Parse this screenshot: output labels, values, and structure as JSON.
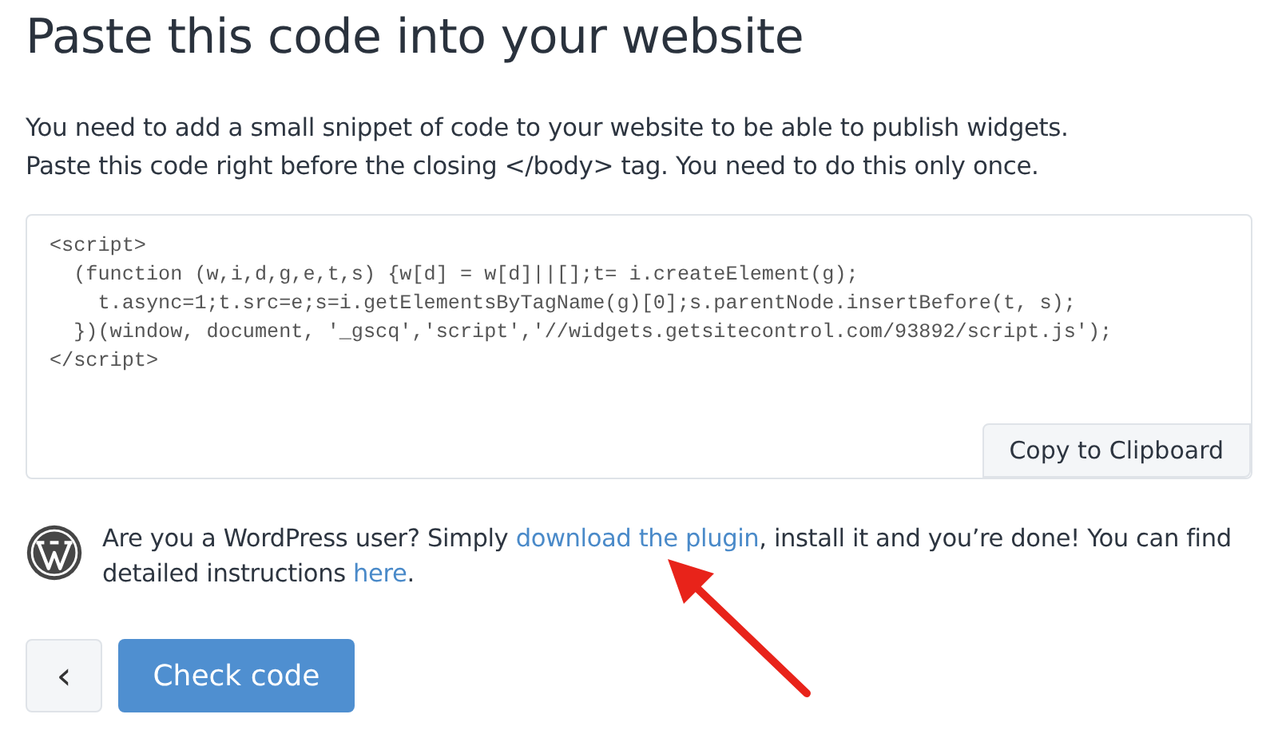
{
  "title": "Paste this code into your website",
  "intro": [
    "You need to add a small snippet of code to your website to be able to publish widgets.",
    "Paste this code right before the closing </body> tag. You need to do this only once."
  ],
  "code_lines": [
    "<script>",
    "  (function (w,i,d,g,e,t,s) {w[d] = w[d]||[];t= i.createElement(g);",
    "    t.async=1;t.src=e;s=i.getElementsByTagName(g)[0];s.parentNode.insertBefore(t, s);",
    "  })(window, document, '_gscq','script','//widgets.getsitecontrol.com/93892/script.js');",
    "</script>"
  ],
  "copy_button": "Copy to Clipboard",
  "wordpress_note": {
    "before": "Are you a WordPress user? Simply ",
    "link": "download the plugin",
    "middle": ", install it and you’re done! You can find detailed instructions ",
    "link2": "here",
    "after": "."
  },
  "back_button": "‹",
  "check_button": "Check code"
}
